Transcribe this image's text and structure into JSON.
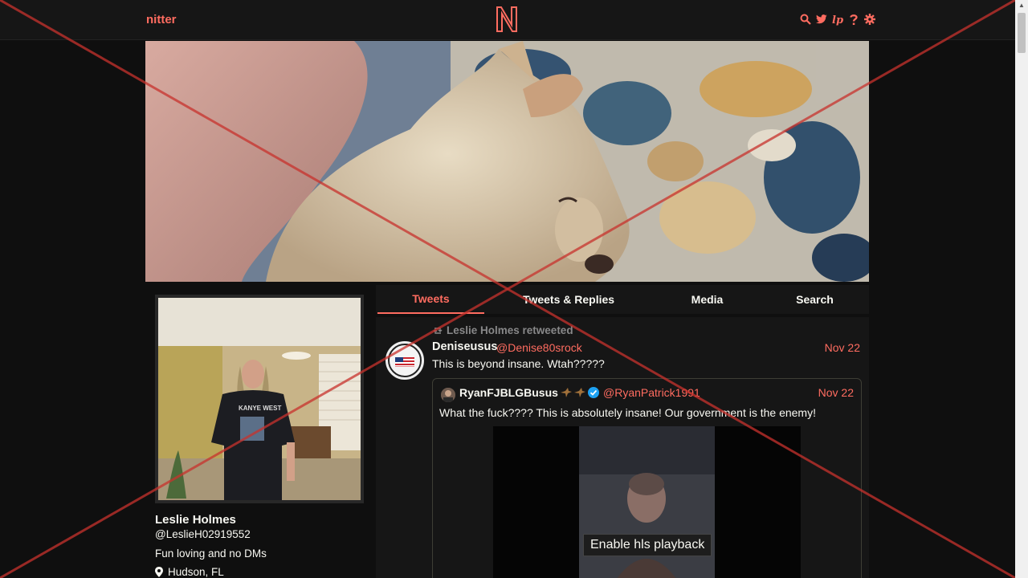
{
  "navbar": {
    "logo": "nitter",
    "center_logo_icon": "nitter-n-logo",
    "icons": [
      "search-icon",
      "twitter-icon",
      "rss-icon",
      "help-icon",
      "gear-icon"
    ]
  },
  "profile": {
    "fullname": "Leslie Holmes",
    "username": "@LeslieH02919552",
    "bio": "Fun loving and no DMs",
    "location": "Hudson, FL",
    "avatar_shirt_text": "KANYE WEST"
  },
  "tabs": [
    {
      "label": "Tweets",
      "active": true
    },
    {
      "label": "Tweets & Replies",
      "active": false
    },
    {
      "label": "Media",
      "active": false
    },
    {
      "label": "Search",
      "active": false
    }
  ],
  "tweet": {
    "retweet_header": "Leslie Holmes retweeted",
    "fullname": "Deniseusus",
    "username": "@Denise80srock",
    "date": "Nov 22",
    "text": "This is beyond insane. Wtah?????",
    "quote": {
      "fullname": "RyanFJBLGBusus",
      "username": "@RyanPatrick1991",
      "date": "Nov 22",
      "text": "What the fuck???? This is absolutely insane! Our government is the enemy!",
      "video_button": "Enable hls playback"
    }
  },
  "colors": {
    "accent": "#ff6c60",
    "background": "#0f0f0f",
    "panel": "#161616",
    "text": "#f8f8f2",
    "muted": "#888889"
  }
}
